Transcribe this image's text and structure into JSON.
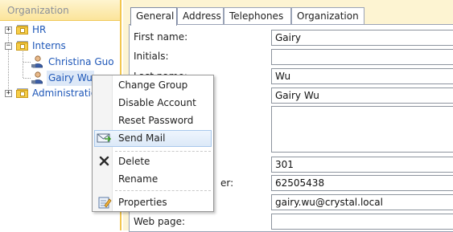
{
  "tree": {
    "header": "Organization",
    "nodes": {
      "hr": "HR",
      "interns": "Interns",
      "christina": "Christina Guo",
      "gairy": "Gairy Wu",
      "administration": "Administration"
    }
  },
  "tabs": {
    "general": "General",
    "address": "Address",
    "telephones": "Telephones",
    "organization": "Organization"
  },
  "form": {
    "first_name_label": "First name:",
    "first_name_value": "Gairy",
    "initials_label": "Initials:",
    "initials_value": "",
    "last_name_label": "Last name:",
    "last_name_value": "Wu",
    "display_name_value": "Gairy Wu",
    "description_value": "",
    "office_value": "301",
    "telephone_label_fragment": "er:",
    "telephone_value": "62505438",
    "email_value": "gairy.wu@crystal.local",
    "web_page_label": "Web page:",
    "web_page_value": ""
  },
  "context_menu": {
    "change_group": "Change Group",
    "disable_account": "Disable Account",
    "reset_password": "Reset Password",
    "send_mail": "Send Mail",
    "delete": "Delete",
    "rename": "Rename",
    "properties": "Properties"
  },
  "colors": {
    "accent_yellow": "#f3c74f",
    "link_blue": "#1e57b8",
    "menu_highlight": "#dce9f8"
  },
  "icons": {
    "expand": "plus-box",
    "collapse": "minus-box",
    "folder": "folder-icon",
    "user": "user-icon",
    "send_mail": "mail-icon",
    "delete": "x-icon",
    "properties": "properties-icon"
  }
}
